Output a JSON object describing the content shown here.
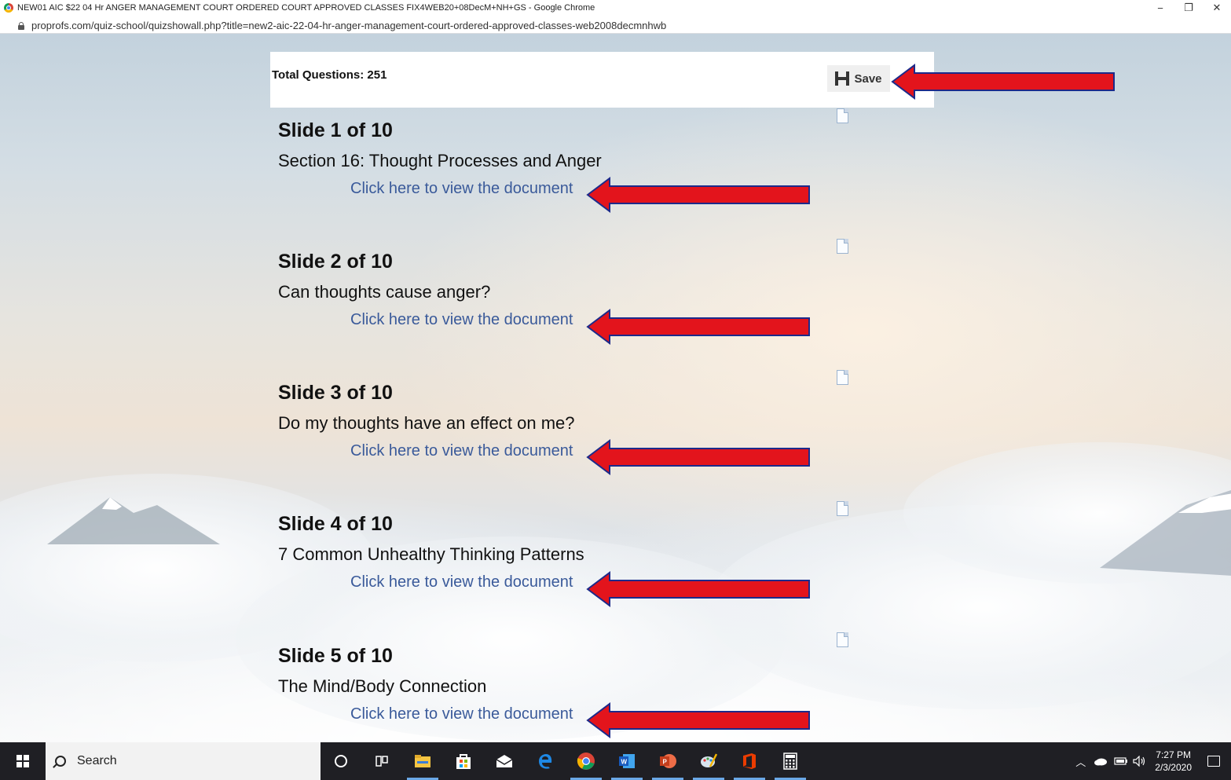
{
  "browser": {
    "window_title": "NEW01 AIC $22 04 Hr ANGER MANAGEMENT COURT ORDERED COURT APPROVED CLASSES FIX4WEB20+08DecM+NH+GS - Google Chrome",
    "url": "proprofs.com/quiz-school/quizshowall.php?title=new2-aic-22-04-hr-anger-management-court-ordered-approved-classes-web2008decmnhwb",
    "minimize": "−",
    "maximize": "❐",
    "close": "✕"
  },
  "header": {
    "total_questions": "Total Questions: 251",
    "save_label": "Save"
  },
  "slides": [
    {
      "title": "Slide 1 of 10",
      "subtitle": "Section 16: Thought Processes and Anger",
      "link": "Click here to view the document"
    },
    {
      "title": "Slide 2 of 10",
      "subtitle": "Can thoughts cause anger?",
      "link": "Click here to view the document"
    },
    {
      "title": "Slide 3 of 10",
      "subtitle": "Do my thoughts have an effect on me?",
      "link": "Click here to view the document"
    },
    {
      "title": "Slide 4 of 10",
      "subtitle": "7 Common Unhealthy Thinking Patterns",
      "link": "Click here to view the document"
    },
    {
      "title": "Slide 5 of 10",
      "subtitle": "The Mind/Body Connection",
      "link": "Click here to view the document"
    }
  ],
  "annotation_color": "#e3141c",
  "link_color": "#3a5a9a",
  "taskbar": {
    "search_label": "Search",
    "time": "7:27 PM",
    "date": "2/3/2020",
    "pinned_icons": [
      "cortana-icon",
      "task-view-icon",
      "file-explorer-icon",
      "store-icon",
      "mail-icon",
      "edge-icon",
      "chrome-icon",
      "word-icon",
      "powerpoint-icon",
      "paint-icon",
      "office-icon",
      "calculator-icon"
    ]
  }
}
